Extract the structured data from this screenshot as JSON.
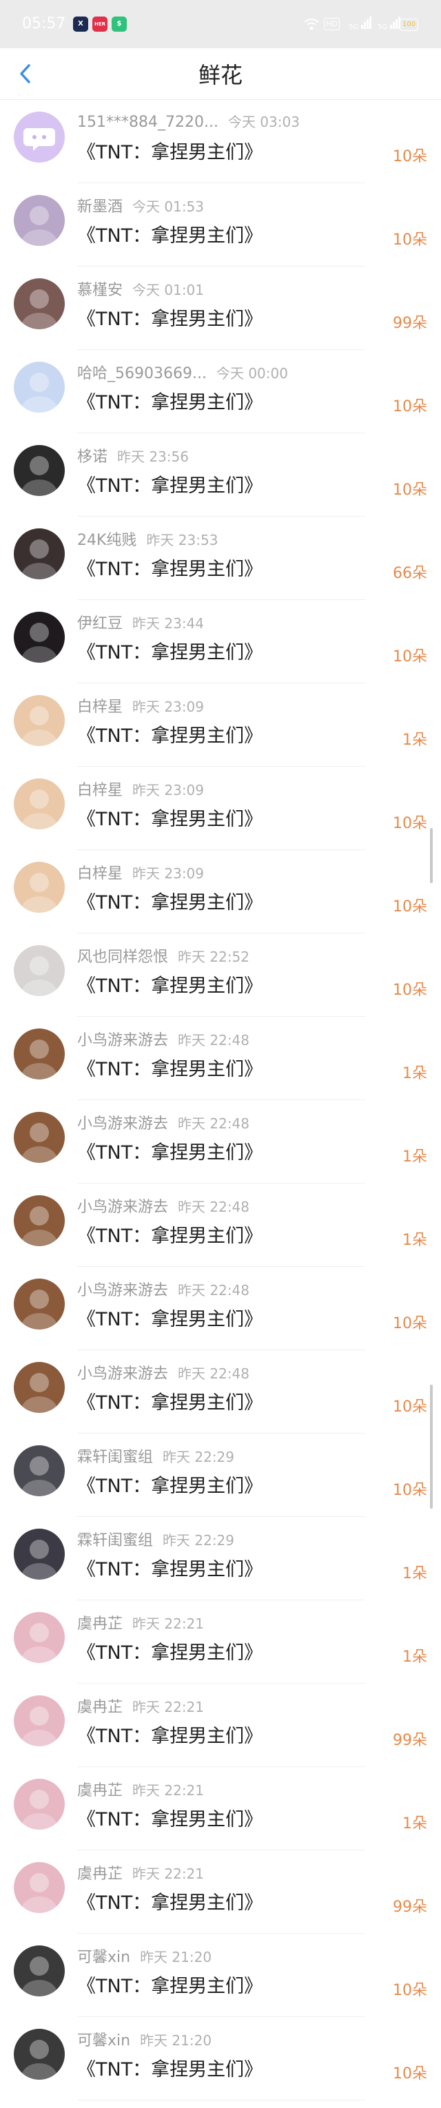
{
  "status": {
    "time": "05:57",
    "apps": [
      "X",
      "HER",
      "$"
    ],
    "signals": [
      "HD",
      "5G",
      "5G",
      "100"
    ]
  },
  "nav": {
    "title": "鲜花"
  },
  "items": [
    {
      "name": "151***884_7220...",
      "time": "今天 03:03",
      "gift": "《TNT：拿捏男主们》",
      "amount": "10朵",
      "avatar": "#d7c4f2"
    },
    {
      "name": "新墨酒",
      "time": "今天 01:53",
      "gift": "《TNT：拿捏男主们》",
      "amount": "10朵",
      "avatar": "#b8a7c9"
    },
    {
      "name": "慕槿安",
      "time": "今天 01:01",
      "gift": "《TNT：拿捏男主们》",
      "amount": "99朵",
      "avatar": "#7b5a55"
    },
    {
      "name": "哈哈_56903669...",
      "time": "今天 00:00",
      "gift": "《TNT：拿捏男主们》",
      "amount": "10朵",
      "avatar": "#c9d8f2"
    },
    {
      "name": "栘诺",
      "time": "昨天 23:56",
      "gift": "《TNT：拿捏男主们》",
      "amount": "10朵",
      "avatar": "#2a2a2a"
    },
    {
      "name": "24K纯贱",
      "time": "昨天 23:53",
      "gift": "《TNT：拿捏男主们》",
      "amount": "66朵",
      "avatar": "#3a3030"
    },
    {
      "name": "伊红豆",
      "time": "昨天 23:44",
      "gift": "《TNT：拿捏男主们》",
      "amount": "10朵",
      "avatar": "#1e1a1e"
    },
    {
      "name": "白梓星",
      "time": "昨天 23:09",
      "gift": "《TNT：拿捏男主们》",
      "amount": "1朵",
      "avatar": "#eac8a8"
    },
    {
      "name": "白梓星",
      "time": "昨天 23:09",
      "gift": "《TNT：拿捏男主们》",
      "amount": "10朵",
      "avatar": "#eac8a8"
    },
    {
      "name": "白梓星",
      "time": "昨天 23:09",
      "gift": "《TNT：拿捏男主们》",
      "amount": "10朵",
      "avatar": "#eac8a8"
    },
    {
      "name": "风也同样怨恨",
      "time": "昨天 22:52",
      "gift": "《TNT：拿捏男主们》",
      "amount": "10朵",
      "avatar": "#d9d4d4"
    },
    {
      "name": "小鸟游来游去",
      "time": "昨天 22:48",
      "gift": "《TNT：拿捏男主们》",
      "amount": "1朵",
      "avatar": "#8a5a3a"
    },
    {
      "name": "小鸟游来游去",
      "time": "昨天 22:48",
      "gift": "《TNT：拿捏男主们》",
      "amount": "1朵",
      "avatar": "#8a5a3a"
    },
    {
      "name": "小鸟游来游去",
      "time": "昨天 22:48",
      "gift": "《TNT：拿捏男主们》",
      "amount": "1朵",
      "avatar": "#8a5a3a"
    },
    {
      "name": "小鸟游来游去",
      "time": "昨天 22:48",
      "gift": "《TNT：拿捏男主们》",
      "amount": "10朵",
      "avatar": "#8a5a3a"
    },
    {
      "name": "小鸟游来游去",
      "time": "昨天 22:48",
      "gift": "《TNT：拿捏男主们》",
      "amount": "10朵",
      "avatar": "#8a5a3a"
    },
    {
      "name": "霖轩闺蜜组",
      "time": "昨天 22:29",
      "gift": "《TNT：拿捏男主们》",
      "amount": "10朵",
      "avatar": "#4a4a52"
    },
    {
      "name": "霖轩闺蜜组",
      "time": "昨天 22:29",
      "gift": "《TNT：拿捏男主们》",
      "amount": "1朵",
      "avatar": "#3c3a44"
    },
    {
      "name": "虞冉芷",
      "time": "昨天 22:21",
      "gift": "《TNT：拿捏男主们》",
      "amount": "1朵",
      "avatar": "#e7b8c4"
    },
    {
      "name": "虞冉芷",
      "time": "昨天 22:21",
      "gift": "《TNT：拿捏男主们》",
      "amount": "99朵",
      "avatar": "#e7b8c4"
    },
    {
      "name": "虞冉芷",
      "time": "昨天 22:21",
      "gift": "《TNT：拿捏男主们》",
      "amount": "1朵",
      "avatar": "#e7b8c4"
    },
    {
      "name": "虞冉芷",
      "time": "昨天 22:21",
      "gift": "《TNT：拿捏男主们》",
      "amount": "99朵",
      "avatar": "#e7b8c4"
    },
    {
      "name": "可馨xin",
      "time": "昨天 21:20",
      "gift": "《TNT：拿捏男主们》",
      "amount": "10朵",
      "avatar": "#3a3a3a"
    },
    {
      "name": "可馨xin",
      "time": "昨天 21:20",
      "gift": "《TNT：拿捏男主们》",
      "amount": "10朵",
      "avatar": "#3a3a3a"
    }
  ]
}
